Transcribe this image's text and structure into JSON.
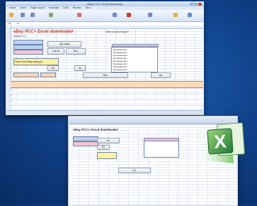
{
  "main_window": {
    "title": "eBay PCC+ Excel download",
    "menu": [
      "Home",
      "Insert",
      "Page Layout",
      "Formulas",
      "Data",
      "Review",
      "View"
    ],
    "worksheet_title": "eBay PCC+ Excel downloader",
    "worksheet_subtitle": "Version 1.1",
    "instructions_note": "Need a valid eBay ID",
    "buttons": {
      "get_stats": "Get Stats",
      "list_all": "List all",
      "run": "Run",
      "go": "Go"
    },
    "prompt_label": "Select the eBay category",
    "listbox_items": [
      "Download item",
      "Download item",
      "Download item",
      "Download item",
      "Download item",
      "Download item",
      "Download item",
      "Download item",
      "Download item"
    ],
    "table_rows": 16
  },
  "back_window": {
    "worksheet_title": "eBay PCC+ Excel downloader",
    "button_label": "Go"
  },
  "logo": {
    "name": "Microsoft Excel",
    "letter": "X"
  },
  "colors": {
    "background": "#0f3f86",
    "accent_red": "#c23b2a",
    "excel_green": "#1f8b3d"
  }
}
